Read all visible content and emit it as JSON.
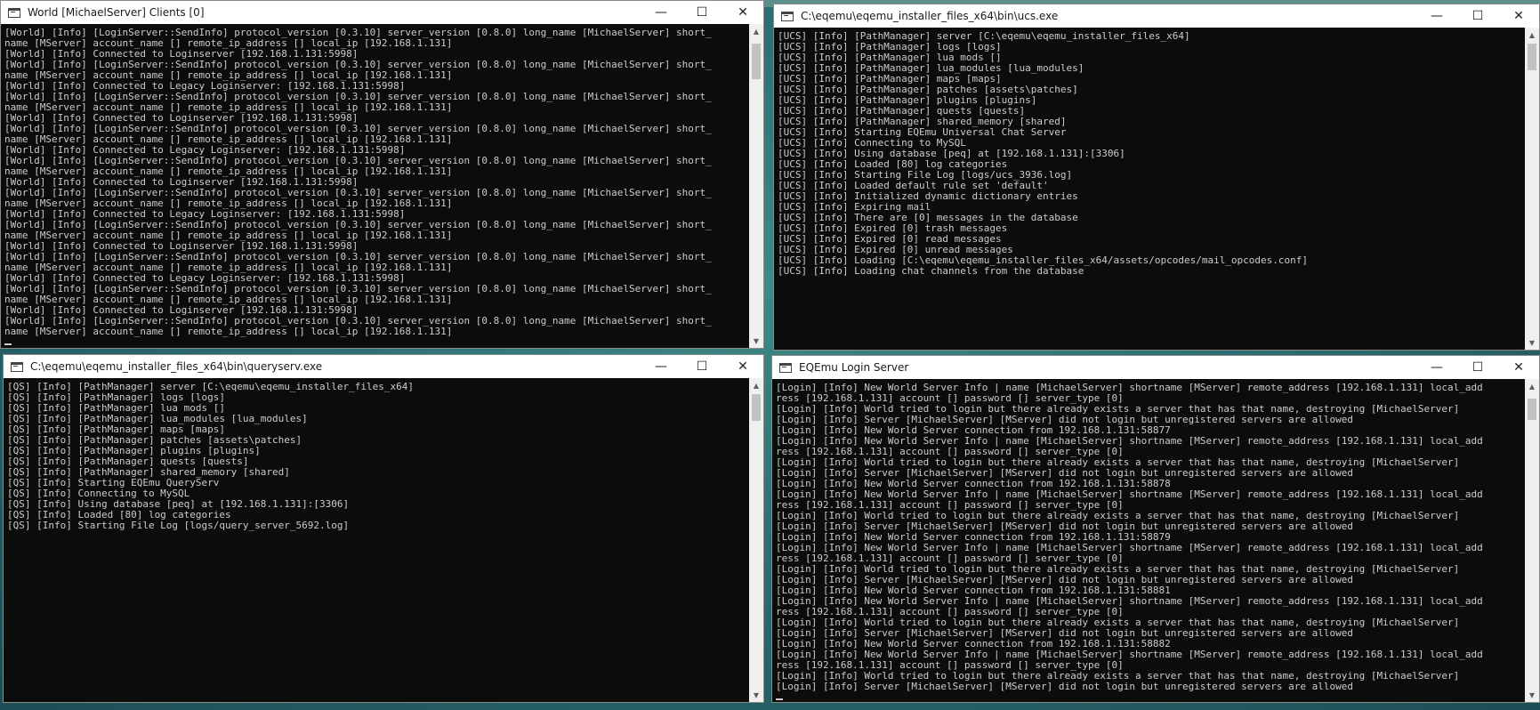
{
  "windows": {
    "world": {
      "title": "World [MichaelServer] Clients [0]",
      "lines": [
        "[World] [Info] [LoginServer::SendInfo] protocol_version [0.3.10] server_version [0.8.0] long_name [MichaelServer] short_",
        "name [MServer] account_name [] remote_ip_address [] local_ip [192.168.1.131]",
        "[World] [Info] Connected to Loginserver [192.168.1.131:5998]",
        "[World] [Info] [LoginServer::SendInfo] protocol_version [0.3.10] server_version [0.8.0] long_name [MichaelServer] short_",
        "name [MServer] account_name [] remote_ip_address [] local_ip [192.168.1.131]",
        "[World] [Info] Connected to Legacy Loginserver: [192.168.1.131:5998]",
        "[World] [Info] [LoginServer::SendInfo] protocol_version [0.3.10] server_version [0.8.0] long_name [MichaelServer] short_",
        "name [MServer] account_name [] remote_ip_address [] local_ip [192.168.1.131]",
        "[World] [Info] Connected to Loginserver [192.168.1.131:5998]",
        "[World] [Info] [LoginServer::SendInfo] protocol_version [0.3.10] server_version [0.8.0] long_name [MichaelServer] short_",
        "name [MServer] account_name [] remote_ip_address [] local_ip [192.168.1.131]",
        "[World] [Info] Connected to Legacy Loginserver: [192.168.1.131:5998]",
        "[World] [Info] [LoginServer::SendInfo] protocol_version [0.3.10] server_version [0.8.0] long_name [MichaelServer] short_",
        "name [MServer] account_name [] remote_ip_address [] local_ip [192.168.1.131]",
        "[World] [Info] Connected to Loginserver [192.168.1.131:5998]",
        "[World] [Info] [LoginServer::SendInfo] protocol_version [0.3.10] server_version [0.8.0] long_name [MichaelServer] short_",
        "name [MServer] account_name [] remote_ip_address [] local_ip [192.168.1.131]",
        "[World] [Info] Connected to Legacy Loginserver: [192.168.1.131:5998]",
        "[World] [Info] [LoginServer::SendInfo] protocol_version [0.3.10] server_version [0.8.0] long_name [MichaelServer] short_",
        "name [MServer] account_name [] remote_ip_address [] local_ip [192.168.1.131]",
        "[World] [Info] Connected to Loginserver [192.168.1.131:5998]",
        "[World] [Info] [LoginServer::SendInfo] protocol_version [0.3.10] server_version [0.8.0] long_name [MichaelServer] short_",
        "name [MServer] account_name [] remote_ip_address [] local_ip [192.168.1.131]",
        "[World] [Info] Connected to Legacy Loginserver: [192.168.1.131:5998]",
        "[World] [Info] [LoginServer::SendInfo] protocol_version [0.3.10] server_version [0.8.0] long_name [MichaelServer] short_",
        "name [MServer] account_name [] remote_ip_address [] local_ip [192.168.1.131]",
        "[World] [Info] Connected to Loginserver [192.168.1.131:5998]",
        "[World] [Info] [LoginServer::SendInfo] protocol_version [0.3.10] server_version [0.8.0] long_name [MichaelServer] short_",
        "name [MServer] account_name [] remote_ip_address [] local_ip [192.168.1.131]"
      ]
    },
    "ucs": {
      "title": "C:\\eqemu\\eqemu_installer_files_x64\\bin\\ucs.exe",
      "lines": [
        "[UCS] [Info] [PathManager] server [C:\\eqemu\\eqemu_installer_files_x64]",
        "[UCS] [Info] [PathManager] logs [logs]",
        "[UCS] [Info] [PathManager] lua mods []",
        "[UCS] [Info] [PathManager] lua_modules [lua_modules]",
        "[UCS] [Info] [PathManager] maps [maps]",
        "[UCS] [Info] [PathManager] patches [assets\\patches]",
        "[UCS] [Info] [PathManager] plugins [plugins]",
        "[UCS] [Info] [PathManager] quests [quests]",
        "[UCS] [Info] [PathManager] shared_memory [shared]",
        "[UCS] [Info] Starting EQEmu Universal Chat Server",
        "[UCS] [Info] Connecting to MySQL",
        "[UCS] [Info] Using database [peq] at [192.168.1.131]:[3306]",
        "[UCS] [Info] Loaded [80] log categories",
        "[UCS] [Info] Starting File Log [logs/ucs_3936.log]",
        "[UCS] [Info] Loaded default rule set 'default'",
        "[UCS] [Info] Initialized dynamic dictionary entries",
        "[UCS] [Info] Expiring mail",
        "[UCS] [Info] There are [0] messages in the database",
        "[UCS] [Info] Expired [0] trash messages",
        "[UCS] [Info] Expired [0] read messages",
        "[UCS] [Info] Expired [0] unread messages",
        "[UCS] [Info] Loading [C:\\eqemu\\eqemu_installer_files_x64/assets/opcodes/mail_opcodes.conf]",
        "[UCS] [Info] Loading chat channels from the database"
      ]
    },
    "qs": {
      "title": "C:\\eqemu\\eqemu_installer_files_x64\\bin\\queryserv.exe",
      "lines": [
        "[QS] [Info] [PathManager] server [C:\\eqemu\\eqemu_installer_files_x64]",
        "[QS] [Info] [PathManager] logs [logs]",
        "[QS] [Info] [PathManager] lua mods []",
        "[QS] [Info] [PathManager] lua_modules [lua_modules]",
        "[QS] [Info] [PathManager] maps [maps]",
        "[QS] [Info] [PathManager] patches [assets\\patches]",
        "[QS] [Info] [PathManager] plugins [plugins]",
        "[QS] [Info] [PathManager] quests [quests]",
        "[QS] [Info] [PathManager] shared_memory [shared]",
        "[QS] [Info] Starting EQEmu QueryServ",
        "[QS] [Info] Connecting to MySQL",
        "[QS] [Info] Using database [peq] at [192.168.1.131]:[3306]",
        "[QS] [Info] Loaded [80] log categories",
        "[QS] [Info] Starting File Log [logs/query_server_5692.log]"
      ]
    },
    "login": {
      "title": "EQEmu Login Server",
      "lines": [
        "[Login] [Info] New World Server Info | name [MichaelServer] shortname [MServer] remote_address [192.168.1.131] local_add",
        "ress [192.168.1.131] account [] password [] server_type [0]",
        "[Login] [Info] World tried to login but there already exists a server that has that name, destroying [MichaelServer]",
        "[Login] [Info] Server [MichaelServer] [MServer] did not login but unregistered servers are allowed",
        "[Login] [Info] New World Server connection from 192.168.1.131:58877",
        "[Login] [Info] New World Server Info | name [MichaelServer] shortname [MServer] remote_address [192.168.1.131] local_add",
        "ress [192.168.1.131] account [] password [] server_type [0]",
        "[Login] [Info] World tried to login but there already exists a server that has that name, destroying [MichaelServer]",
        "[Login] [Info] Server [MichaelServer] [MServer] did not login but unregistered servers are allowed",
        "[Login] [Info] New World Server connection from 192.168.1.131:58878",
        "[Login] [Info] New World Server Info | name [MichaelServer] shortname [MServer] remote_address [192.168.1.131] local_add",
        "ress [192.168.1.131] account [] password [] server_type [0]",
        "[Login] [Info] World tried to login but there already exists a server that has that name, destroying [MichaelServer]",
        "[Login] [Info] Server [MichaelServer] [MServer] did not login but unregistered servers are allowed",
        "[Login] [Info] New World Server connection from 192.168.1.131:58879",
        "[Login] [Info] New World Server Info | name [MichaelServer] shortname [MServer] remote_address [192.168.1.131] local_add",
        "ress [192.168.1.131] account [] password [] server_type [0]",
        "[Login] [Info] World tried to login but there already exists a server that has that name, destroying [MichaelServer]",
        "[Login] [Info] Server [MichaelServer] [MServer] did not login but unregistered servers are allowed",
        "[Login] [Info] New World Server connection from 192.168.1.131:58881",
        "[Login] [Info] New World Server Info | name [MichaelServer] shortname [MServer] remote_address [192.168.1.131] local_add",
        "ress [192.168.1.131] account [] password [] server_type [0]",
        "[Login] [Info] World tried to login but there already exists a server that has that name, destroying [MichaelServer]",
        "[Login] [Info] Server [MichaelServer] [MServer] did not login but unregistered servers are allowed",
        "[Login] [Info] New World Server connection from 192.168.1.131:58882",
        "[Login] [Info] New World Server Info | name [MichaelServer] shortname [MServer] remote_address [192.168.1.131] local_add",
        "ress [192.168.1.131] account [] password [] server_type [0]",
        "[Login] [Info] World tried to login but there already exists a server that has that name, destroying [MichaelServer]",
        "[Login] [Info] Server [MichaelServer] [MServer] did not login but unregistered servers are allowed"
      ]
    }
  },
  "controls": {
    "minimize": "—",
    "maximize": "☐",
    "close": "✕"
  },
  "icons": {
    "window": "console-window-icon",
    "scroll_up": "▲",
    "scroll_down": "▼"
  },
  "colors": {
    "console_bg": "#0c0c0c",
    "console_text": "#cccccc",
    "titlebar_bg": "#ffffff"
  }
}
